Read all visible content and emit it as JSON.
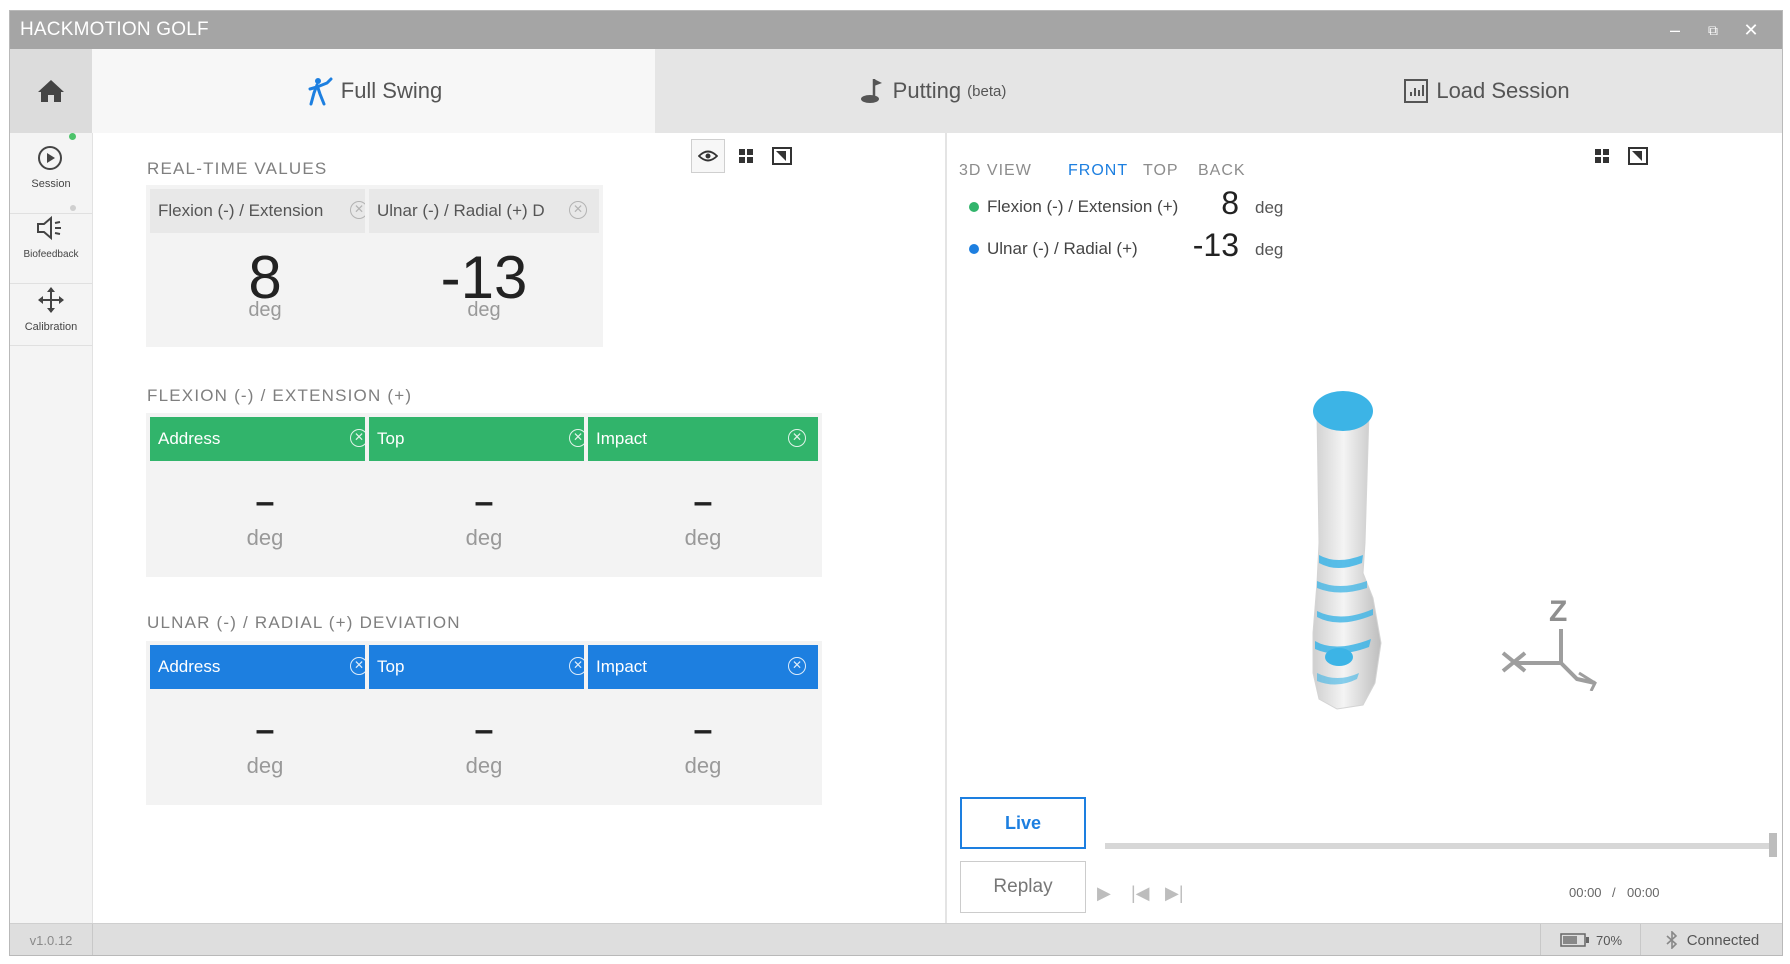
{
  "app": {
    "title": "HACKMOTION GOLF"
  },
  "window_controls": {
    "minimize": "–",
    "restore": "⧉",
    "close": "✕"
  },
  "tabs": [
    {
      "label": "Full Swing",
      "suffix": "",
      "icon": "golfer-icon",
      "active": true
    },
    {
      "label": "Putting",
      "suffix": "(beta)",
      "icon": "putter-icon",
      "active": false
    },
    {
      "label": "Load Session",
      "suffix": "",
      "icon": "chart-file-icon",
      "active": false
    }
  ],
  "sidebar": {
    "items": [
      {
        "label": "Session",
        "icon": "play-circle-icon",
        "indicator": "green"
      },
      {
        "label": "Biofeedback",
        "icon": "speaker-icon",
        "indicator": "grey"
      },
      {
        "label": "Calibration",
        "icon": "move-arrows-icon",
        "indicator": "none"
      }
    ]
  },
  "realtime": {
    "title": "REAL-TIME VALUES",
    "cards": [
      {
        "label": "Flexion (-) / Extension",
        "value": "8",
        "unit": "deg"
      },
      {
        "label": "Ulnar (-) / Radial (+) D",
        "value": "-13",
        "unit": "deg"
      }
    ]
  },
  "flexion": {
    "title": "FLEXION (-) / EXTENSION (+)",
    "cards": [
      {
        "label": "Address",
        "value": "–",
        "unit": "deg"
      },
      {
        "label": "Top",
        "value": "–",
        "unit": "deg"
      },
      {
        "label": "Impact",
        "value": "–",
        "unit": "deg"
      }
    ]
  },
  "ulnar": {
    "title": "ULNAR (-) / RADIAL (+) DEVIATION",
    "cards": [
      {
        "label": "Address",
        "value": "–",
        "unit": "deg"
      },
      {
        "label": "Top",
        "value": "–",
        "unit": "deg"
      },
      {
        "label": "Impact",
        "value": "–",
        "unit": "deg"
      }
    ]
  },
  "view3d": {
    "title": "3D VIEW",
    "tabs": [
      "FRONT",
      "TOP",
      "BACK"
    ],
    "active_tab": "FRONT",
    "readouts": [
      {
        "label": "Flexion (-) / Extension (+)",
        "value": "8",
        "unit": "deg",
        "color": "#31b46b"
      },
      {
        "label": "Ulnar (-) / Radial (+)",
        "value": "-13",
        "unit": "deg",
        "color": "#1d7fe0"
      }
    ],
    "axis_label": "Z",
    "live_label": "Live",
    "replay_label": "Replay",
    "time_current": "00:00",
    "time_separator": "/",
    "time_total": "00:00",
    "playback_progress": 1.0
  },
  "status": {
    "version": "v1.0.12",
    "battery": "70%",
    "connection": "Connected"
  },
  "colors": {
    "green": "#31b46b",
    "blue": "#1d7fe0",
    "titlebar": "#a5a5a5",
    "wrist_cap": "#3cb4e6"
  }
}
